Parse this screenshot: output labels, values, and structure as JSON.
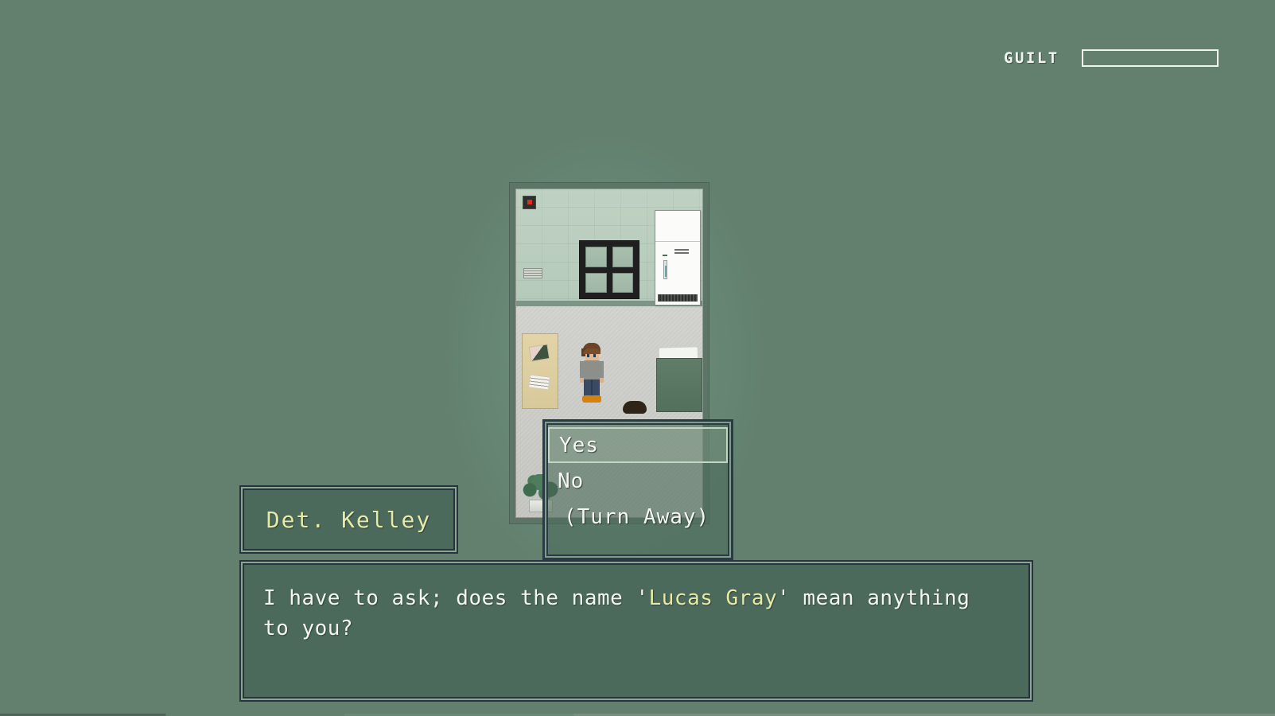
{
  "hud": {
    "guilt_label": "GUILT",
    "guilt_percent": 0,
    "guilt_value_text": "0%",
    "bar_border_color": "#f0f3ee"
  },
  "scene": {
    "name": "apartment-interior",
    "background_color": "#63806f",
    "room_wall_color": "#b0c6b5",
    "room_floor_color": "#cfd0cb",
    "objects": [
      {
        "name": "security-camera",
        "label": "Security Camera"
      },
      {
        "name": "wall-vent",
        "label": "Vent"
      },
      {
        "name": "dark-window",
        "label": "Window"
      },
      {
        "name": "refrigerator",
        "label": "Refrigerator"
      },
      {
        "name": "bed",
        "label": "Bed"
      },
      {
        "name": "pillow",
        "label": "Pillow"
      },
      {
        "name": "corkboard",
        "label": "Corkboard"
      },
      {
        "name": "potted-plant",
        "label": "Potted Plant"
      }
    ],
    "characters": [
      {
        "name": "player-sprite",
        "label": "Player"
      },
      {
        "name": "npc-sprite",
        "label": "NPC"
      }
    ]
  },
  "choices": {
    "selected_index": 0,
    "items": [
      {
        "label": "Yes",
        "selected": true,
        "indent": false
      },
      {
        "label": "No",
        "selected": false,
        "indent": false
      },
      {
        "label": "(Turn Away)",
        "selected": false,
        "indent": true
      }
    ]
  },
  "dialogue": {
    "speaker": "Det. Kelley",
    "text_before": "I have to ask; does the name '",
    "highlight": "Lucas Gray",
    "text_after": "' mean anything\nto you?",
    "full_text": "I have to ask; does the name 'Lucas Gray' mean anything to you?",
    "highlight_color": "#e7eaa6",
    "text_color": "#f3f5f0",
    "box_color": "#4c6a5c"
  }
}
